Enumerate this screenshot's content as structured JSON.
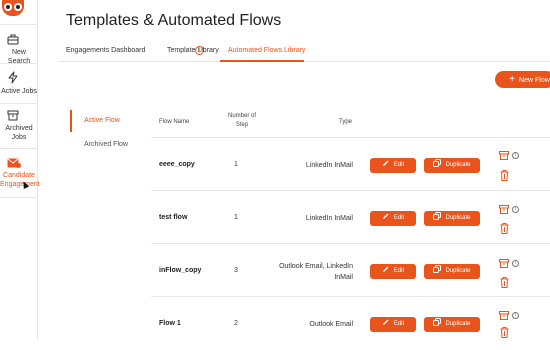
{
  "colors": {
    "accent": "#e8541c",
    "text": "#222222",
    "divider": "#e6e6e6"
  },
  "sidebar": {
    "items": [
      {
        "label": "New Search",
        "icon": "briefcase-icon"
      },
      {
        "label": "Active Jobs",
        "icon": "lightning-icon"
      },
      {
        "label": "Archived Jobs",
        "icon": "archive-box-icon"
      },
      {
        "label": "Candidate Engagement",
        "icon": "envelope-icon",
        "active": true
      }
    ]
  },
  "page": {
    "title": "Templates & Automated Flows"
  },
  "tabs": [
    {
      "label": "Engagements Dashboard",
      "info_icon": "i"
    },
    {
      "label": "Template Library"
    },
    {
      "label": "Automated Flows Library",
      "active": true
    }
  ],
  "toolbar": {
    "new_flow_label": "New Flow",
    "plus": "+"
  },
  "flow_nav": [
    {
      "label": "Active Flow",
      "active": true
    },
    {
      "label": "Archived Flow"
    }
  ],
  "table": {
    "headers": {
      "name": "Flow Name",
      "steps": "Number of Step",
      "type": "Type"
    },
    "rows": [
      {
        "name": "eeee_copy",
        "steps": "1",
        "type": "LinkedIn InMail"
      },
      {
        "name": "test flow",
        "steps": "1",
        "type": "LinkedIn InMail"
      },
      {
        "name": "inFlow_copy",
        "steps": "3",
        "type": "Outlook Email, LinkedIn InMail"
      },
      {
        "name": "Flow 1",
        "steps": "2",
        "type": "Outlook Email"
      }
    ],
    "edit_label": "Edit",
    "duplicate_label": "Duplicate",
    "info_glyph": "i"
  }
}
